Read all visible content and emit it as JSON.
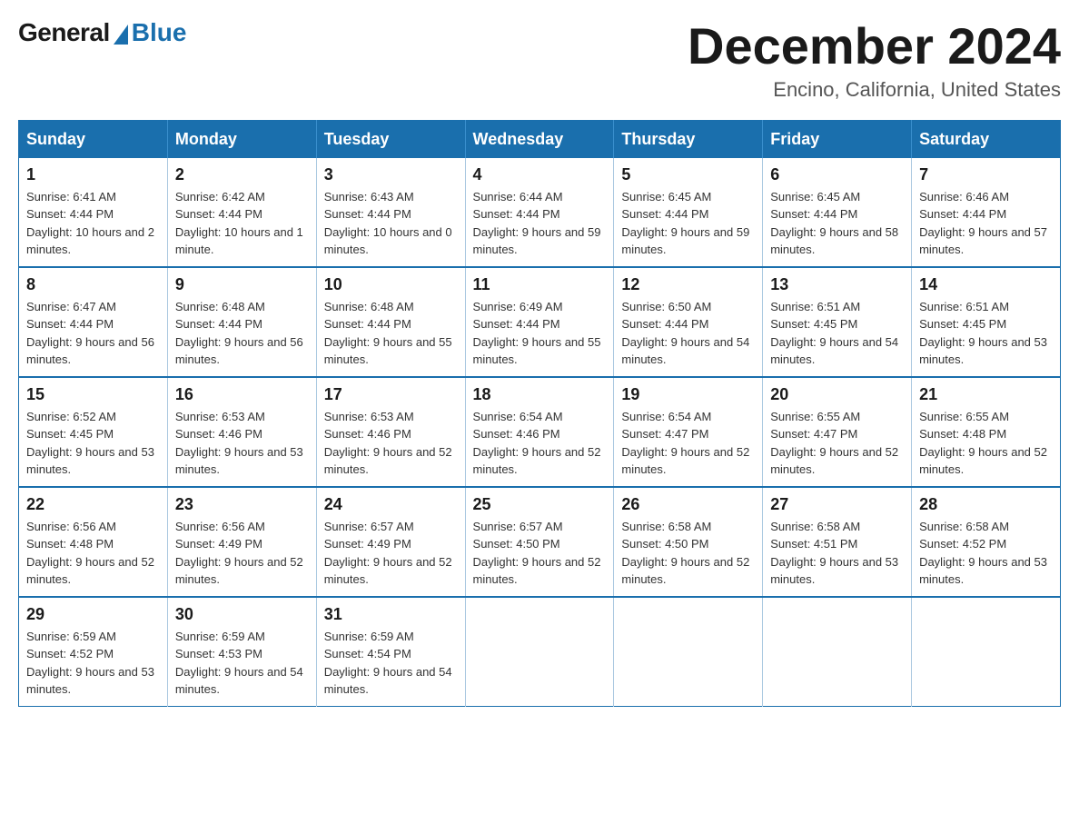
{
  "logo": {
    "general": "General",
    "blue": "Blue"
  },
  "title": {
    "month": "December 2024",
    "location": "Encino, California, United States"
  },
  "weekdays": [
    "Sunday",
    "Monday",
    "Tuesday",
    "Wednesday",
    "Thursday",
    "Friday",
    "Saturday"
  ],
  "weeks": [
    [
      {
        "day": "1",
        "sunrise": "6:41 AM",
        "sunset": "4:44 PM",
        "daylight": "10 hours and 2 minutes."
      },
      {
        "day": "2",
        "sunrise": "6:42 AM",
        "sunset": "4:44 PM",
        "daylight": "10 hours and 1 minute."
      },
      {
        "day": "3",
        "sunrise": "6:43 AM",
        "sunset": "4:44 PM",
        "daylight": "10 hours and 0 minutes."
      },
      {
        "day": "4",
        "sunrise": "6:44 AM",
        "sunset": "4:44 PM",
        "daylight": "9 hours and 59 minutes."
      },
      {
        "day": "5",
        "sunrise": "6:45 AM",
        "sunset": "4:44 PM",
        "daylight": "9 hours and 59 minutes."
      },
      {
        "day": "6",
        "sunrise": "6:45 AM",
        "sunset": "4:44 PM",
        "daylight": "9 hours and 58 minutes."
      },
      {
        "day": "7",
        "sunrise": "6:46 AM",
        "sunset": "4:44 PM",
        "daylight": "9 hours and 57 minutes."
      }
    ],
    [
      {
        "day": "8",
        "sunrise": "6:47 AM",
        "sunset": "4:44 PM",
        "daylight": "9 hours and 56 minutes."
      },
      {
        "day": "9",
        "sunrise": "6:48 AM",
        "sunset": "4:44 PM",
        "daylight": "9 hours and 56 minutes."
      },
      {
        "day": "10",
        "sunrise": "6:48 AM",
        "sunset": "4:44 PM",
        "daylight": "9 hours and 55 minutes."
      },
      {
        "day": "11",
        "sunrise": "6:49 AM",
        "sunset": "4:44 PM",
        "daylight": "9 hours and 55 minutes."
      },
      {
        "day": "12",
        "sunrise": "6:50 AM",
        "sunset": "4:44 PM",
        "daylight": "9 hours and 54 minutes."
      },
      {
        "day": "13",
        "sunrise": "6:51 AM",
        "sunset": "4:45 PM",
        "daylight": "9 hours and 54 minutes."
      },
      {
        "day": "14",
        "sunrise": "6:51 AM",
        "sunset": "4:45 PM",
        "daylight": "9 hours and 53 minutes."
      }
    ],
    [
      {
        "day": "15",
        "sunrise": "6:52 AM",
        "sunset": "4:45 PM",
        "daylight": "9 hours and 53 minutes."
      },
      {
        "day": "16",
        "sunrise": "6:53 AM",
        "sunset": "4:46 PM",
        "daylight": "9 hours and 53 minutes."
      },
      {
        "day": "17",
        "sunrise": "6:53 AM",
        "sunset": "4:46 PM",
        "daylight": "9 hours and 52 minutes."
      },
      {
        "day": "18",
        "sunrise": "6:54 AM",
        "sunset": "4:46 PM",
        "daylight": "9 hours and 52 minutes."
      },
      {
        "day": "19",
        "sunrise": "6:54 AM",
        "sunset": "4:47 PM",
        "daylight": "9 hours and 52 minutes."
      },
      {
        "day": "20",
        "sunrise": "6:55 AM",
        "sunset": "4:47 PM",
        "daylight": "9 hours and 52 minutes."
      },
      {
        "day": "21",
        "sunrise": "6:55 AM",
        "sunset": "4:48 PM",
        "daylight": "9 hours and 52 minutes."
      }
    ],
    [
      {
        "day": "22",
        "sunrise": "6:56 AM",
        "sunset": "4:48 PM",
        "daylight": "9 hours and 52 minutes."
      },
      {
        "day": "23",
        "sunrise": "6:56 AM",
        "sunset": "4:49 PM",
        "daylight": "9 hours and 52 minutes."
      },
      {
        "day": "24",
        "sunrise": "6:57 AM",
        "sunset": "4:49 PM",
        "daylight": "9 hours and 52 minutes."
      },
      {
        "day": "25",
        "sunrise": "6:57 AM",
        "sunset": "4:50 PM",
        "daylight": "9 hours and 52 minutes."
      },
      {
        "day": "26",
        "sunrise": "6:58 AM",
        "sunset": "4:50 PM",
        "daylight": "9 hours and 52 minutes."
      },
      {
        "day": "27",
        "sunrise": "6:58 AM",
        "sunset": "4:51 PM",
        "daylight": "9 hours and 53 minutes."
      },
      {
        "day": "28",
        "sunrise": "6:58 AM",
        "sunset": "4:52 PM",
        "daylight": "9 hours and 53 minutes."
      }
    ],
    [
      {
        "day": "29",
        "sunrise": "6:59 AM",
        "sunset": "4:52 PM",
        "daylight": "9 hours and 53 minutes."
      },
      {
        "day": "30",
        "sunrise": "6:59 AM",
        "sunset": "4:53 PM",
        "daylight": "9 hours and 54 minutes."
      },
      {
        "day": "31",
        "sunrise": "6:59 AM",
        "sunset": "4:54 PM",
        "daylight": "9 hours and 54 minutes."
      },
      null,
      null,
      null,
      null
    ]
  ],
  "labels": {
    "sunrise_prefix": "Sunrise: ",
    "sunset_prefix": "Sunset: ",
    "daylight_prefix": "Daylight: "
  }
}
